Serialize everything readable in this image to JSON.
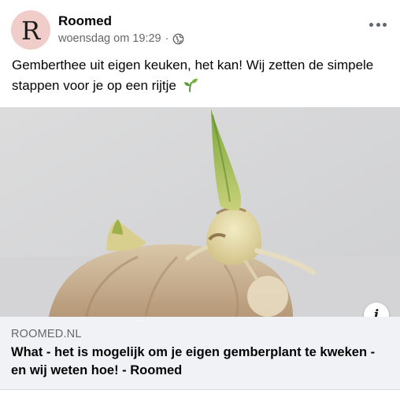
{
  "post": {
    "page_name": "Roomed",
    "avatar_letter": "R",
    "timestamp": "woensdag om 19:29",
    "separator": "·",
    "privacy_icon": "globe-icon",
    "more_icon": "more-horizontal-icon",
    "text": "Gemberthee uit eigen keuken, het kan! Wij zetten de simpele stappen voor je op een rijtje",
    "emoji_icon": "seedling-icon"
  },
  "link_preview": {
    "image_subject": "ginger root with sprout",
    "info_icon": "info-icon",
    "info_glyph": "i",
    "domain": "ROOMED.NL",
    "title": "What - het is mogelijk om je eigen gemberplant te kweken - en wij weten hoe! - Roomed"
  },
  "colors": {
    "avatar_bg": "#f0cdc9",
    "meta_text": "#65676b",
    "card_bg": "#f0f2f5"
  }
}
